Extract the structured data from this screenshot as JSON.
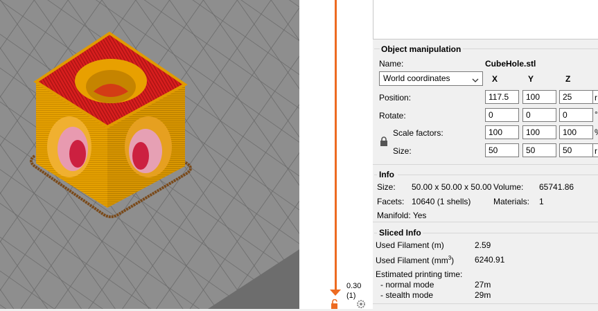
{
  "slider": {
    "layer_height": "0.30",
    "layer_number": "(1)"
  },
  "object_manipulation": {
    "title": "Object manipulation",
    "name_label": "Name:",
    "name_value": "CubeHole.stl",
    "coord_select": "World coordinates",
    "axes": [
      "X",
      "Y",
      "Z"
    ],
    "position_label": "Position:",
    "position": [
      "117.5",
      "100",
      "25"
    ],
    "position_unit": "r",
    "rotate_label": "Rotate:",
    "rotate": [
      "0",
      "0",
      "0"
    ],
    "rotate_unit": "°",
    "scale_label": "Scale factors:",
    "scale": [
      "100",
      "100",
      "100"
    ],
    "scale_unit": "%",
    "size_label": "Size:",
    "size": [
      "50",
      "50",
      "50"
    ],
    "size_unit": "r"
  },
  "info": {
    "title": "Info",
    "size_label": "Size:",
    "size_value": "50.00 x 50.00 x 50.00",
    "volume_label": "Volume:",
    "volume_value": "65741.86",
    "facets_label": "Facets:",
    "facets_value": "10640 (1 shells)",
    "materials_label": "Materials:",
    "materials_value": "1",
    "manifold_label": "Manifold:",
    "manifold_value": "Yes"
  },
  "sliced_info": {
    "title": "Sliced Info",
    "filament_m_label": "Used Filament (m)",
    "filament_m_value": "2.59",
    "filament_mm3_label": "Used Filament (mm",
    "filament_mm3_sup": "3",
    "filament_mm3_close": ")",
    "filament_mm3_value": "6240.91",
    "est_time_label": "Estimated printing time:",
    "normal_label": "- normal mode",
    "normal_value": "27m",
    "stealth_label": "- stealth mode",
    "stealth_value": "29m"
  },
  "colors": {
    "accent": "#ed6b21",
    "model_orange": "#e8a000",
    "model_red": "#d81e1e",
    "bed_grey": "#8c8c8c"
  }
}
